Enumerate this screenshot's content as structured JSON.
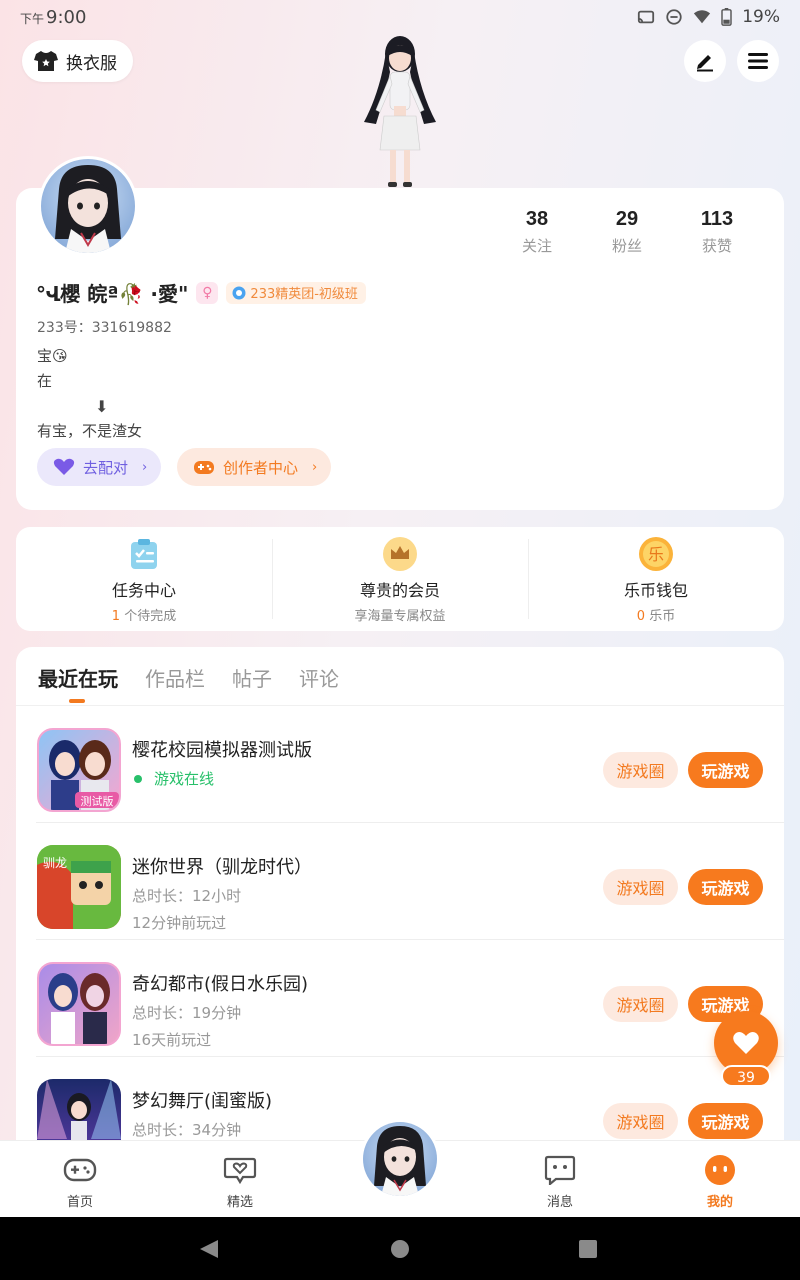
{
  "status_bar": {
    "ampm": "下午",
    "time": "9:00",
    "battery": "19%"
  },
  "header": {
    "outfit_label": "换衣服",
    "edit_icon": "edit-icon",
    "menu_icon": "menu-icon"
  },
  "profile": {
    "stats": [
      {
        "num": "38",
        "label": "关注"
      },
      {
        "num": "29",
        "label": "粉丝"
      },
      {
        "num": "113",
        "label": "获赞"
      }
    ],
    "nickname": "°Վ櫻 皖ª🥀 ·愛\"",
    "gender_symbol": "♀",
    "badge": "233精英团-初级班",
    "uid": "233号：331619882",
    "bio_line1": "宝😘",
    "bio_line2": "在",
    "bio_arrow": "⬇",
    "bio_line3": "有宝，不是渣女",
    "pair_button": "去配对",
    "creator_button": "创作者中心"
  },
  "services": [
    {
      "title": "任务中心",
      "count": "1",
      "sub": " 个待完成",
      "icon": "clipboard-icon"
    },
    {
      "title": "尊贵的会员",
      "count": "",
      "sub": "享海量专属权益",
      "icon": "crown-icon"
    },
    {
      "title": "乐币钱包",
      "count": "0",
      "sub": " 乐币",
      "icon": "coin-icon",
      "coin_char": "乐"
    }
  ],
  "tabs": [
    "最近在玩",
    "作品栏",
    "帖子",
    "评论"
  ],
  "games": [
    {
      "title": "樱花校园模拟器测试版",
      "status": "游戏在线",
      "meta1": "",
      "meta2": "",
      "badge": "测试版"
    },
    {
      "title": "迷你世界（驯龙时代）",
      "status": "",
      "meta1": "总时长：12小时",
      "meta2": "12分钟前玩过",
      "badge": "驯龙"
    },
    {
      "title": "奇幻都市(假日水乐园)",
      "status": "",
      "meta1": "总时长：19分钟",
      "meta2": "16天前玩过",
      "badge": ""
    },
    {
      "title": "梦幻舞厅(闺蜜版)",
      "status": "",
      "meta1": "总时长：34分钟",
      "meta2": "",
      "badge": ""
    }
  ],
  "game_buttons": {
    "circle": "游戏圈",
    "play": "玩游戏"
  },
  "float_like": {
    "count": "39"
  },
  "bottom_nav": [
    {
      "label": "首页",
      "icon": "gamepad-icon"
    },
    {
      "label": "精选",
      "icon": "heart-chat-icon"
    },
    {
      "label": "消息",
      "icon": "message-icon"
    },
    {
      "label": "我的",
      "icon": "profile-face-icon"
    }
  ],
  "colors": {
    "accent": "#f77a1e",
    "online": "#28c06a",
    "purple": "#6f5fe0"
  }
}
